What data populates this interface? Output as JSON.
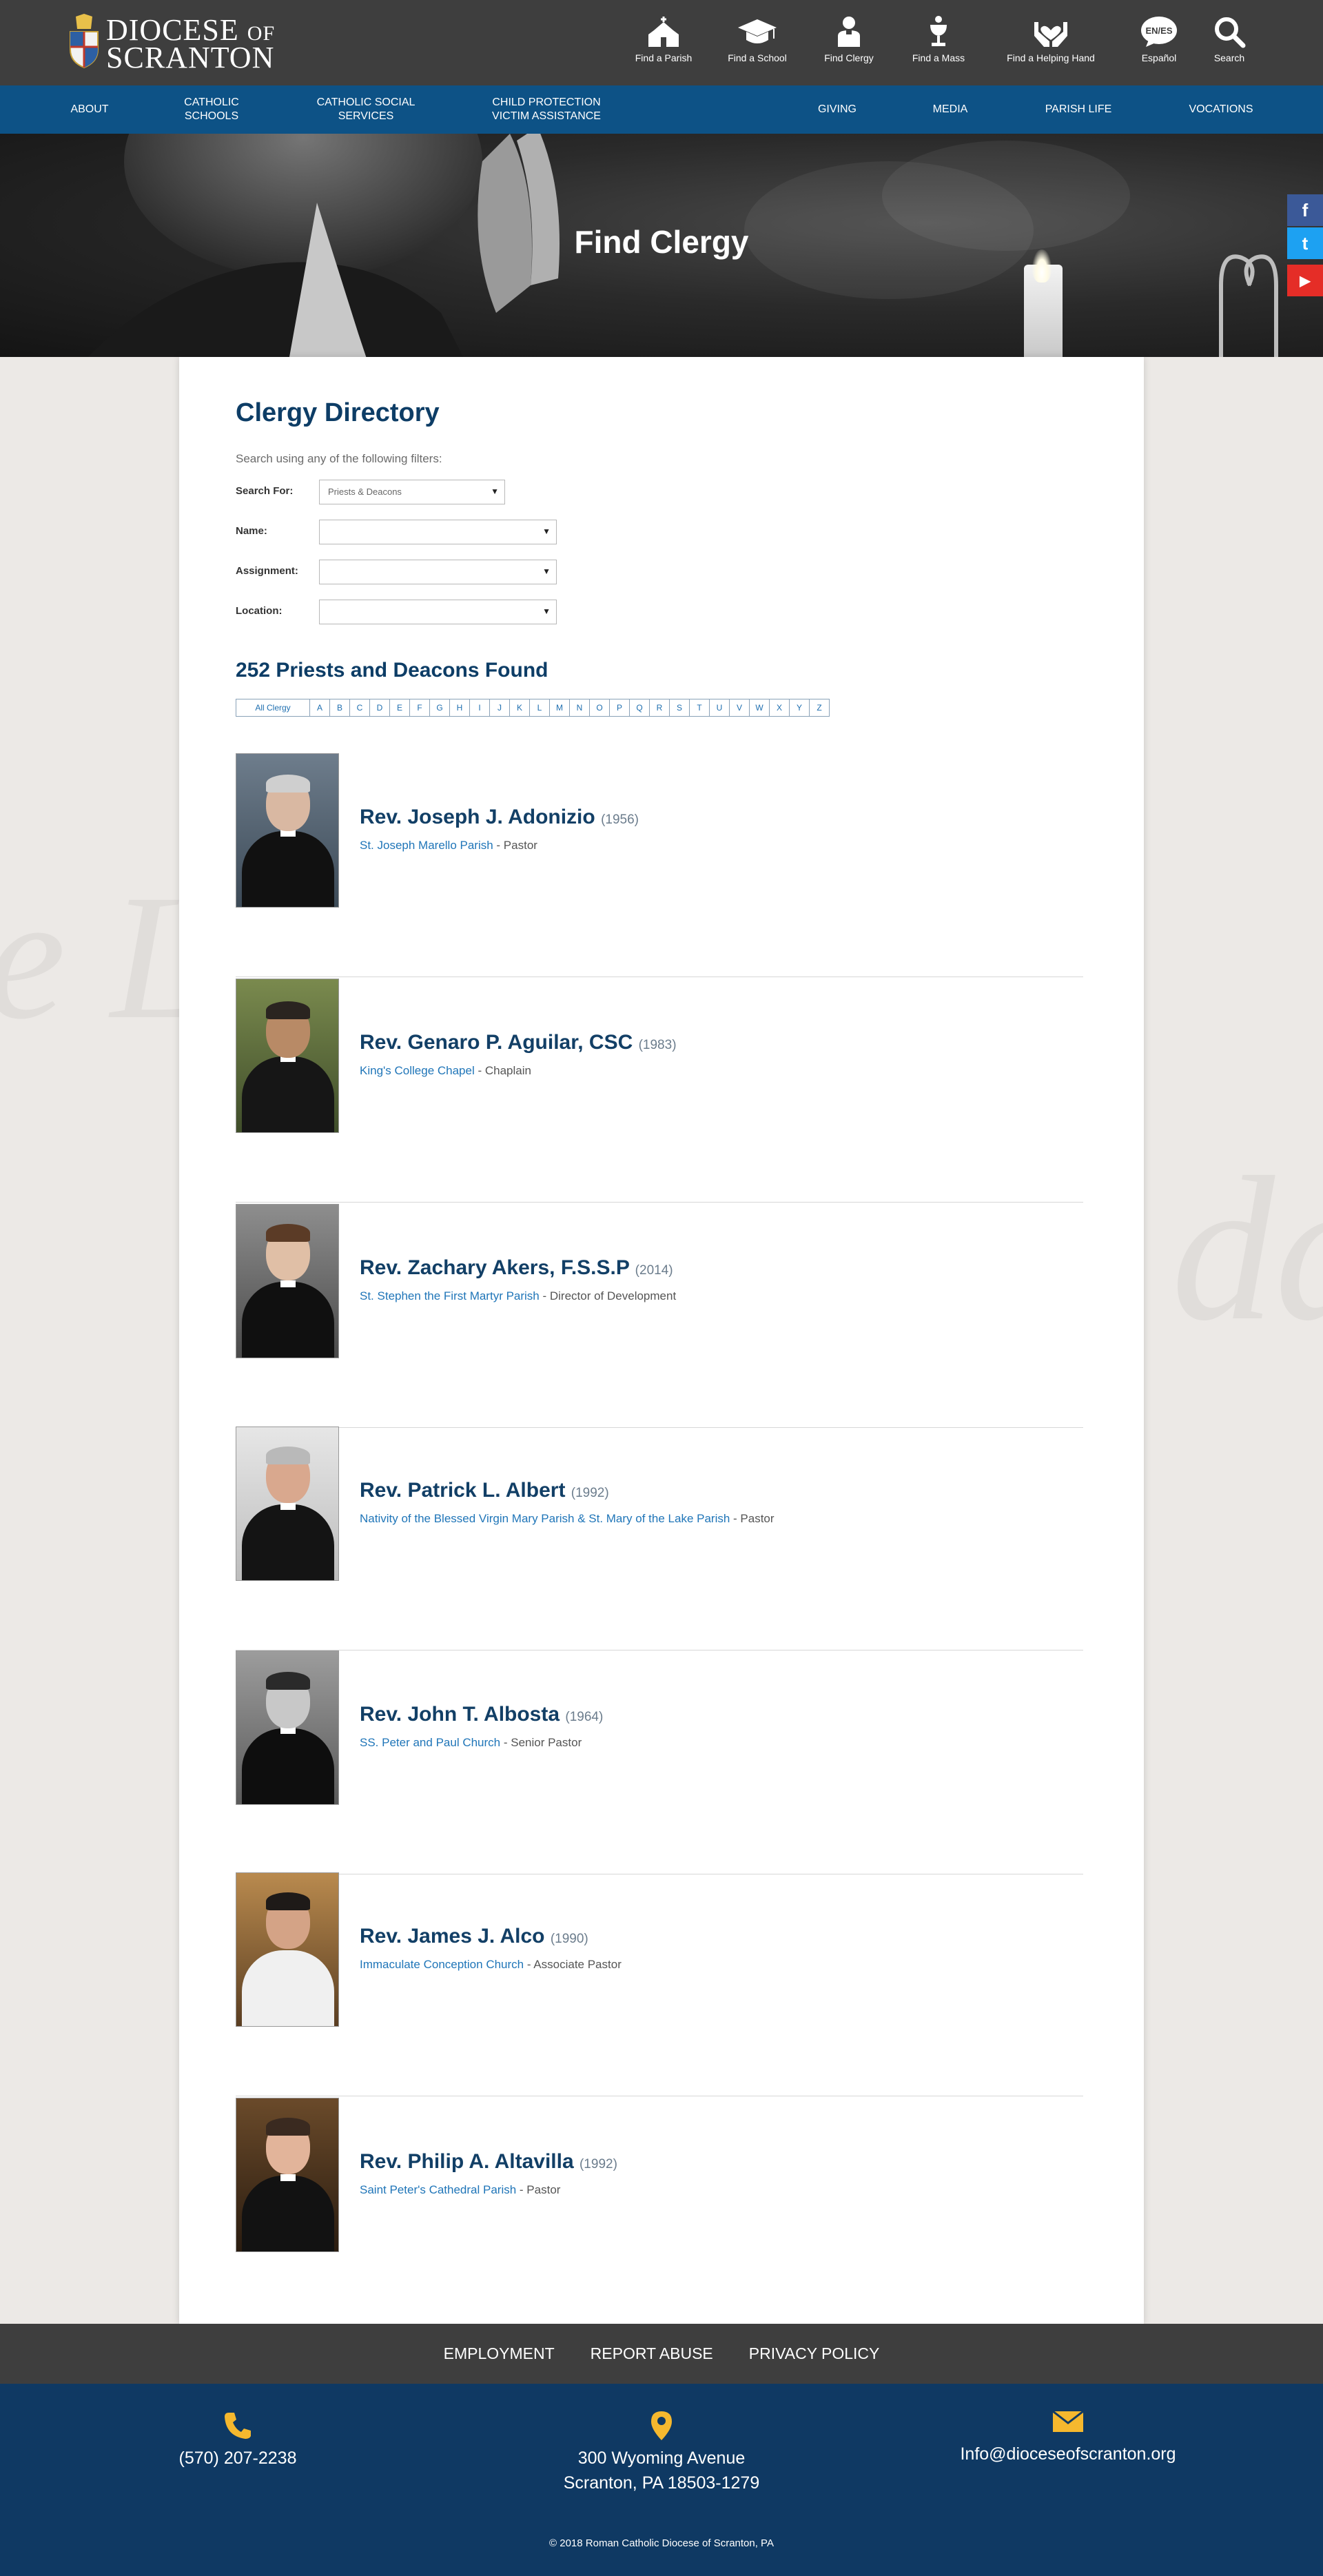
{
  "header": {
    "logo_line1": "DIOCESE",
    "logo_of": "OF",
    "logo_line2": "SCRANTON",
    "quick_links": [
      {
        "label": "Find a Parish",
        "icon": "church-icon"
      },
      {
        "label": "Find a School",
        "icon": "graduation-cap-icon"
      },
      {
        "label": "Find Clergy",
        "icon": "clergy-icon"
      },
      {
        "label": "Find a Mass",
        "icon": "chalice-icon"
      },
      {
        "label": "Find a Helping Hand",
        "icon": "hands-heart-icon"
      },
      {
        "label": "Español",
        "icon": "language-bubble-icon",
        "badge": "EN/ES"
      },
      {
        "label": "Search",
        "icon": "search-icon"
      }
    ]
  },
  "nav": {
    "items": [
      {
        "label": "About"
      },
      {
        "label": "Catholic Schools"
      },
      {
        "label": "Catholic Social Services"
      },
      {
        "label": "Child Protection Victim Assistance"
      },
      {
        "label": "Giving"
      },
      {
        "label": "Media"
      },
      {
        "label": "Parish Life"
      },
      {
        "label": "Vocations"
      }
    ]
  },
  "hero": {
    "title": "Find Clergy"
  },
  "social": {
    "facebook": "f",
    "twitter": "t",
    "youtube": "▶"
  },
  "directory": {
    "title": "Clergy Directory",
    "intro": "Search using any of the following filters:",
    "filters": [
      {
        "label": "Search For:",
        "value": "Priests & Deacons"
      },
      {
        "label": "Name:",
        "value": ""
      },
      {
        "label": "Assignment:",
        "value": ""
      },
      {
        "label": "Location:",
        "value": ""
      }
    ],
    "results_heading": "252 Priests and Deacons Found",
    "alphabet": [
      "All Clergy",
      "A",
      "B",
      "C",
      "D",
      "E",
      "F",
      "G",
      "H",
      "I",
      "J",
      "K",
      "L",
      "M",
      "N",
      "O",
      "P",
      "Q",
      "R",
      "S",
      "T",
      "U",
      "V",
      "W",
      "X",
      "Y",
      "Z"
    ]
  },
  "clergy": [
    {
      "name": "Rev. Joseph J. Adonizio",
      "year": "(1956)",
      "parish": "St. Joseph Marello Parish",
      "role": " - Pastor"
    },
    {
      "name": "Rev. Genaro P. Aguilar, CSC",
      "year": "(1983)",
      "parish": "King's College Chapel ",
      "role": " - Chaplain"
    },
    {
      "name": "Rev. Zachary Akers, F.S.S.P",
      "year": "(2014)",
      "parish": "St. Stephen the First Martyr Parish",
      "role": " - Director of Development"
    },
    {
      "name": "Rev. Patrick L. Albert",
      "year": "(1992)",
      "parish": "Nativity of the Blessed Virgin Mary Parish & St. Mary of the Lake Parish",
      "role": " - Pastor"
    },
    {
      "name": "Rev. John T. Albosta",
      "year": "(1964)",
      "parish": "SS. Peter and Paul Church",
      "role": " - Senior Pastor"
    },
    {
      "name": "Rev. James J. Alco",
      "year": "(1990)",
      "parish": "Immaculate Conception Church",
      "role": " - Associate Pastor"
    },
    {
      "name": "Rev. Philip A. Altavilla",
      "year": "(1992)",
      "parish": "Saint Peter's Cathedral Parish",
      "role": " - Pastor"
    }
  ],
  "footer": {
    "links": [
      "Employment",
      "Report Abuse",
      "Privacy Policy"
    ],
    "phone": "(570) 207-2238",
    "address_line1": "300 Wyoming Avenue",
    "address_line2": "Scranton, PA 18503-1279",
    "email": "Info@dioceseofscranton.org",
    "copyright": "© 2018 Roman Catholic Diocese of Scranton, PA"
  },
  "colors": {
    "header_bg": "#3e3e3e",
    "nav_bg": "#0d5286",
    "title_blue": "#0d3d66",
    "link_blue": "#1f75b8",
    "footer_bg": "#0f3963",
    "icon_gold": "#f5b82e"
  }
}
